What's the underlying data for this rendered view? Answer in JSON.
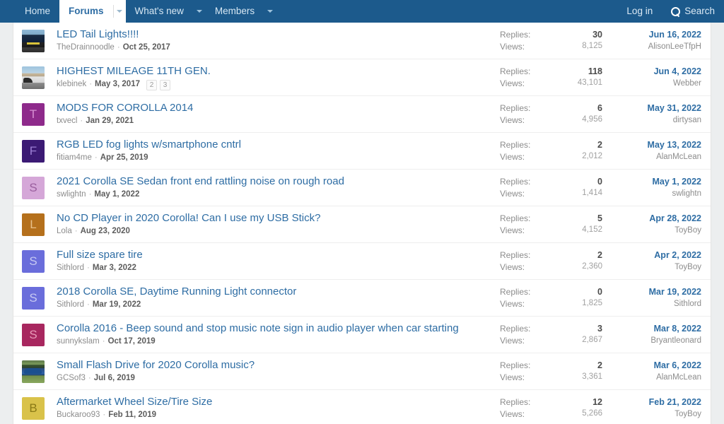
{
  "navbar": {
    "background": "#1c5a8c",
    "items": [
      {
        "label": "Home",
        "has_caret": false,
        "active": false
      },
      {
        "label": "Forums",
        "has_caret": true,
        "active": true
      },
      {
        "label": "What's new",
        "has_caret": true,
        "active": false
      },
      {
        "label": "Members",
        "has_caret": true,
        "active": false
      }
    ],
    "login_label": "Log in",
    "search_label": "Search",
    "search_icon": "search-icon"
  },
  "labels": {
    "replies": "Replies:",
    "views": "Views:",
    "meta_separator": "·"
  },
  "threads": [
    {
      "title": "LED Tail Lights!!!!",
      "author": "TheDrainnoodle",
      "date": "Oct 25, 2017",
      "pages": [],
      "avatar": {
        "type": "photo",
        "variant": "photo-a",
        "letter": "",
        "bg": "#1a2d44"
      },
      "replies": "30",
      "views": "8,125",
      "last_date": "Jun 16, 2022",
      "last_user": "AlisonLeeTfpH"
    },
    {
      "title": "HIGHEST MILEAGE 11TH GEN.",
      "author": "klebinek",
      "date": "May 3, 2017",
      "pages": [
        "2",
        "3"
      ],
      "avatar": {
        "type": "photo",
        "variant": "photo-b",
        "letter": "",
        "bg": "#9ec4de"
      },
      "replies": "118",
      "views": "43,101",
      "last_date": "Jun 4, 2022",
      "last_user": "Webber"
    },
    {
      "title": "MODS FOR COROLLA 2014",
      "author": "txvecl",
      "date": "Jan 29, 2021",
      "pages": [],
      "avatar": {
        "type": "letter",
        "variant": "",
        "letter": "T",
        "bg": "#8e2a8b",
        "fg": "#d68fd2"
      },
      "replies": "6",
      "views": "4,956",
      "last_date": "May 31, 2022",
      "last_user": "dirtysan"
    },
    {
      "title": "RGB LED fog lights w/smartphone cntrl",
      "author": "fitiam4me",
      "date": "Apr 25, 2019",
      "pages": [],
      "avatar": {
        "type": "letter",
        "variant": "",
        "letter": "F",
        "bg": "#3b1a74",
        "fg": "#9b7fd4"
      },
      "replies": "2",
      "views": "2,012",
      "last_date": "May 13, 2022",
      "last_user": "AlanMcLean"
    },
    {
      "title": "2021 Corolla SE Sedan front end rattling noise on rough road",
      "author": "swlightn",
      "date": "May 1, 2022",
      "pages": [],
      "avatar": {
        "type": "letter",
        "variant": "",
        "letter": "S",
        "bg": "#d5a7d8",
        "fg": "#9a5f9e"
      },
      "replies": "0",
      "views": "1,414",
      "last_date": "May 1, 2022",
      "last_user": "swlightn"
    },
    {
      "title": "No CD Player in 2020 Corolla! Can I use my USB Stick?",
      "author": "Lola",
      "date": "Aug 23, 2020",
      "pages": [],
      "avatar": {
        "type": "letter",
        "variant": "",
        "letter": "L",
        "bg": "#b5701c",
        "fg": "#e8c08a"
      },
      "replies": "5",
      "views": "4,152",
      "last_date": "Apr 28, 2022",
      "last_user": "ToyBoy"
    },
    {
      "title": "Full size spare tire",
      "author": "Sithlord",
      "date": "Mar 3, 2022",
      "pages": [],
      "avatar": {
        "type": "letter",
        "variant": "",
        "letter": "S",
        "bg": "#6a6ddb",
        "fg": "#c7c9f2"
      },
      "replies": "2",
      "views": "2,360",
      "last_date": "Apr 2, 2022",
      "last_user": "ToyBoy"
    },
    {
      "title": "2018 Corolla SE, Daytime Running Light connector",
      "author": "Sithlord",
      "date": "Mar 19, 2022",
      "pages": [],
      "avatar": {
        "type": "letter",
        "variant": "",
        "letter": "S",
        "bg": "#6a6ddb",
        "fg": "#c7c9f2"
      },
      "replies": "0",
      "views": "1,825",
      "last_date": "Mar 19, 2022",
      "last_user": "Sithlord"
    },
    {
      "title": "Corolla 2016 - Beep sound and stop music note sign in audio player when car starting",
      "author": "sunnykslam",
      "date": "Oct 17, 2019",
      "pages": [],
      "avatar": {
        "type": "letter",
        "variant": "",
        "letter": "S",
        "bg": "#a8275f",
        "fg": "#e89ab8"
      },
      "replies": "3",
      "views": "2,867",
      "last_date": "Mar 8, 2022",
      "last_user": "Bryantleonard"
    },
    {
      "title": "Small Flash Drive for 2020 Corolla music?",
      "author": "GCSof3",
      "date": "Jul 6, 2019",
      "pages": [],
      "avatar": {
        "type": "photo",
        "variant": "photo-c",
        "letter": "",
        "bg": "#2f63a8"
      },
      "replies": "2",
      "views": "3,361",
      "last_date": "Mar 6, 2022",
      "last_user": "AlanMcLean"
    },
    {
      "title": "Aftermarket Wheel Size/Tire Size",
      "author": "Buckaroo93",
      "date": "Feb 11, 2019",
      "pages": [],
      "avatar": {
        "type": "letter",
        "variant": "",
        "letter": "B",
        "bg": "#d9c24a",
        "fg": "#8a7a16"
      },
      "replies": "12",
      "views": "5,266",
      "last_date": "Feb 21, 2022",
      "last_user": "ToyBoy"
    }
  ]
}
